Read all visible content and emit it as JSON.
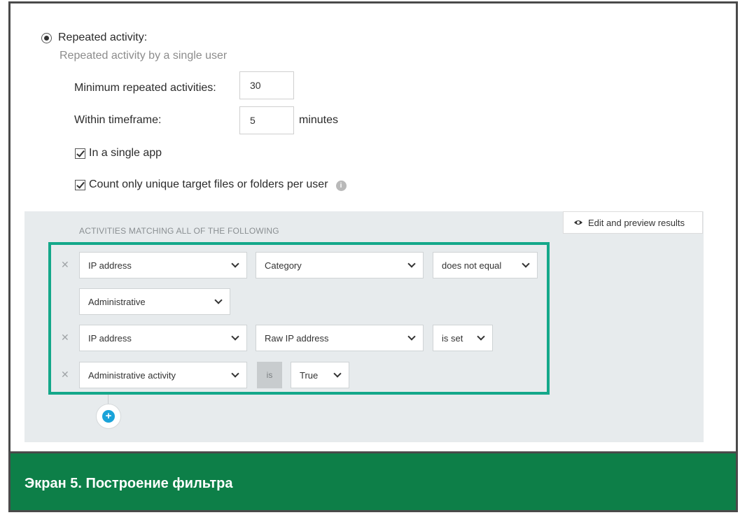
{
  "activity": {
    "radio_label": "Repeated activity:",
    "subtitle": "Repeated activity by a single user",
    "min_label": "Minimum repeated activities:",
    "min_value": "30",
    "timeframe_label": "Within timeframe:",
    "timeframe_value": "5",
    "timeframe_unit": "minutes",
    "single_app_label": "In a single app",
    "unique_label": "Count only unique target files or folders per user",
    "info_glyph": "i"
  },
  "filters": {
    "preview_label": "Edit and preview results",
    "heading": "ACTIVITIES MATCHING ALL OF THE FOLLOWING",
    "remove_glyph": "✕",
    "add_glyph": "+",
    "rules": [
      {
        "field": "IP address",
        "subfield": "Category",
        "operator": "does not equal",
        "value": "Administrative"
      },
      {
        "field": "IP address",
        "subfield": "Raw IP address",
        "operator": "is set"
      },
      {
        "field": "Administrative activity",
        "operator": "is",
        "value": "True"
      }
    ]
  },
  "caption": "Экран 5. Построение фильтра",
  "colors": {
    "highlight": "#14a88a",
    "caption_bg": "#0d7f48",
    "add_button": "#1aa3d9",
    "panel_bg": "#e7ebed"
  }
}
